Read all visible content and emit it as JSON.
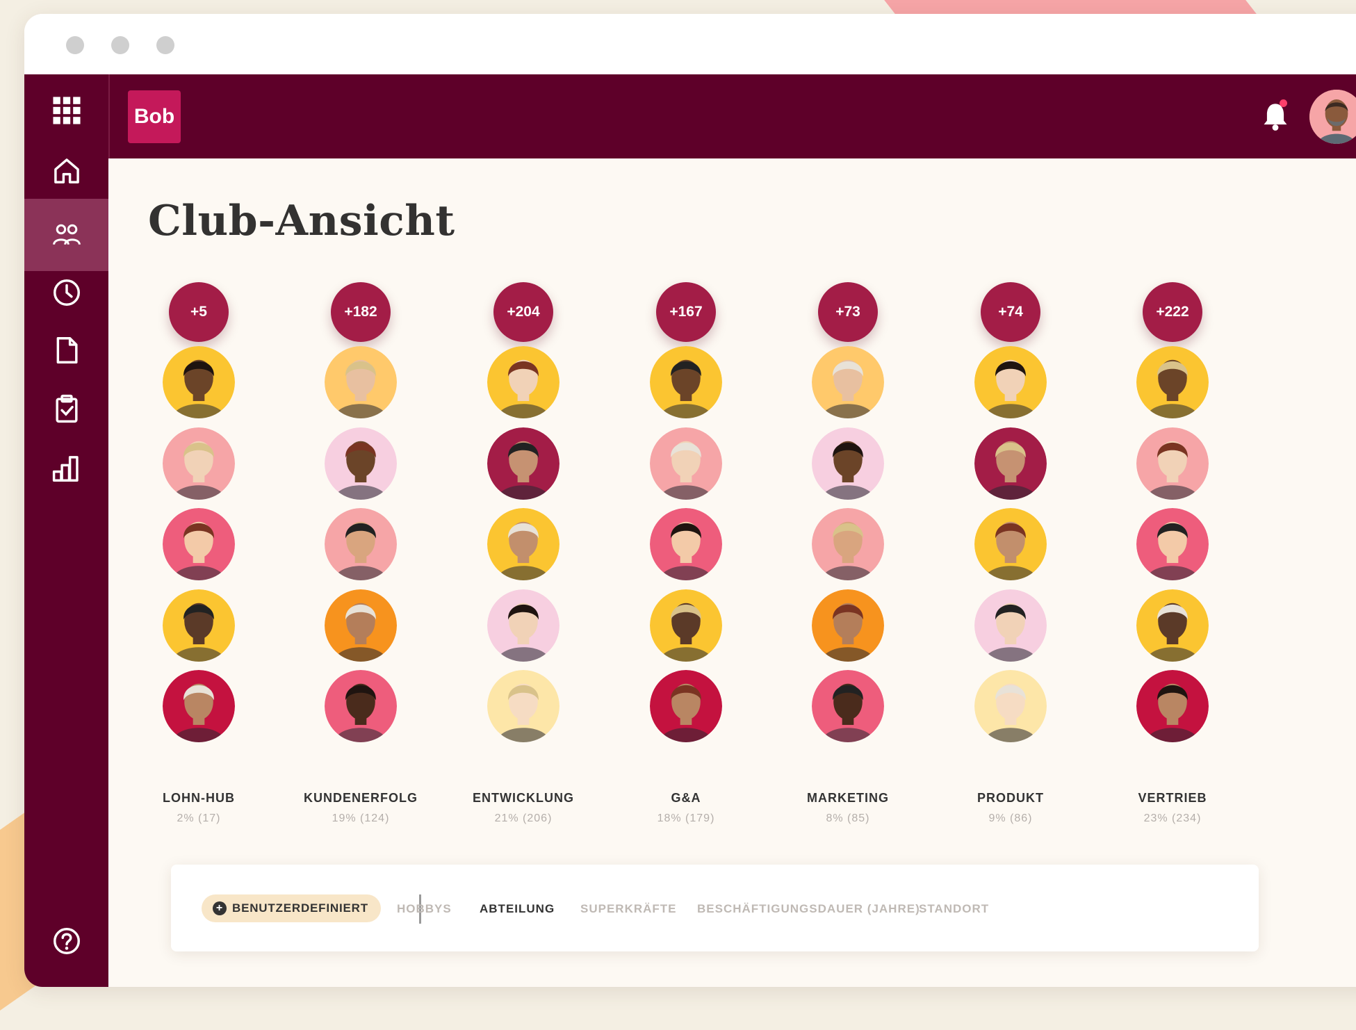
{
  "app": {
    "logo_text": "Bob",
    "brand_color": "#5e0029",
    "accent_color": "#a31d47"
  },
  "sidebar": {
    "items": [
      {
        "icon": "grid-icon"
      },
      {
        "icon": "home-icon"
      },
      {
        "icon": "people-icon",
        "active": true
      },
      {
        "icon": "clock-icon"
      },
      {
        "icon": "document-icon"
      },
      {
        "icon": "clipboard-icon"
      },
      {
        "icon": "bar-chart-icon"
      },
      {
        "icon": "help-icon"
      }
    ]
  },
  "header": {
    "notification_icon": "bell-icon",
    "has_unread": true
  },
  "page": {
    "title": "Club-Ansicht"
  },
  "columns": [
    {
      "count": "+5",
      "name": "LOHN-HUB",
      "stat": "2% (17)"
    },
    {
      "count": "+182",
      "name": "KUNDENERFOLG",
      "stat": "19% (124)"
    },
    {
      "count": "+204",
      "name": "ENTWICKLUNG",
      "stat": "21% (206)"
    },
    {
      "count": "+167",
      "name": "G&A",
      "stat": "18% (179)"
    },
    {
      "count": "+73",
      "name": "MARKETING",
      "stat": "8% (85)"
    },
    {
      "count": "+74",
      "name": "PRODUKT",
      "stat": "9% (86)"
    },
    {
      "count": "+222",
      "name": "VERTRIEB",
      "stat": "23% (234)"
    }
  ],
  "filters": {
    "custom_label": "BENUTZERDEFINIERT",
    "tabs": [
      {
        "label": "HOBBYS",
        "active": false
      },
      {
        "label": "ABTEILUNG",
        "active": true
      },
      {
        "label": "SUPERKRÄFTE",
        "active": false
      },
      {
        "label": "BESCHÄFTIGUNGSDAUER (JAHRE)",
        "active": false
      },
      {
        "label": "STANDORT",
        "active": false
      }
    ]
  }
}
